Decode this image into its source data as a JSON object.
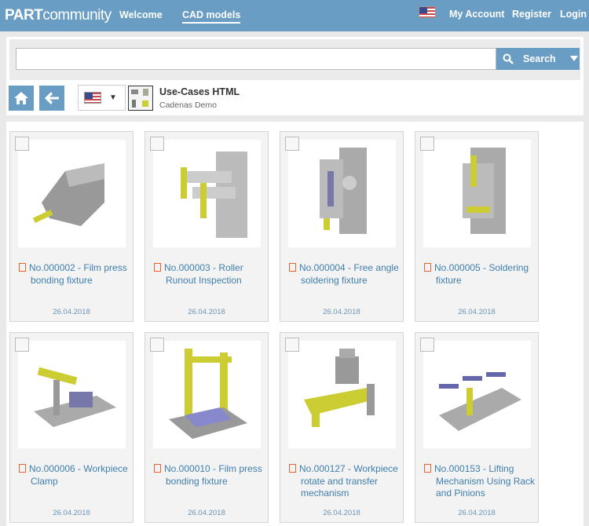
{
  "header": {
    "logo_bold": "PART",
    "logo_light": "community",
    "nav": [
      {
        "label": "Welcome"
      },
      {
        "label": "CAD models"
      }
    ],
    "right": [
      {
        "label": "My Account"
      },
      {
        "label": "Register"
      },
      {
        "label": "Login"
      }
    ],
    "flag_icon": "us-flag-icon"
  },
  "search": {
    "value": "",
    "placeholder": "",
    "button": "Search"
  },
  "catalog": {
    "title": "Use-Cases HTML",
    "subtitle": "Cadenas Demo"
  },
  "colors": {
    "accent": "#6a9dc4",
    "link": "#3f7fae",
    "doc_icon": "#e8632c"
  },
  "cards": [
    {
      "title": "No.000002 - Film press bonding fixture",
      "date": "26.04.2018"
    },
    {
      "title": "No.000003 - Roller Runout Inspection",
      "date": "26.04.2018"
    },
    {
      "title": "No.000004 - Free angle soldering fixture",
      "date": "26.04.2018"
    },
    {
      "title": "No.000005 - Soldering fixture",
      "date": "26.04.2018"
    },
    {
      "title": "No.000006 - Workpiece Clamp",
      "date": "26.04.2018"
    },
    {
      "title": "No.000010 - Film press bonding fixture",
      "date": "26.04.2018"
    },
    {
      "title": "No.000127 - Workpiece rotate and transfer mechanism",
      "date": "26.04.2018"
    },
    {
      "title": "No.000153 - Lifting Mechanism Using Rack and Pinions",
      "date": "26.04.2018"
    }
  ]
}
